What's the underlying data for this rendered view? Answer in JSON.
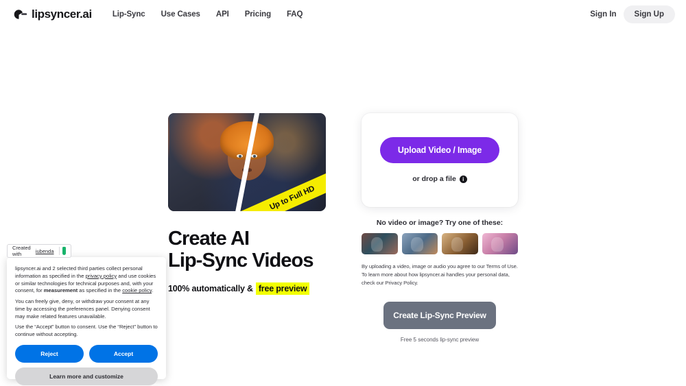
{
  "header": {
    "logo_icon": "lipsyncer-mark-icon",
    "brand": "lipsyncer.ai",
    "nav": [
      {
        "label": "Lip-Sync"
      },
      {
        "label": "Use Cases"
      },
      {
        "label": "API"
      },
      {
        "label": "Pricing"
      },
      {
        "label": "FAQ"
      }
    ],
    "sign_in": "Sign In",
    "sign_up": "Sign Up"
  },
  "hero": {
    "ribbon": "Up to Full HD",
    "title_line1": "Create AI",
    "title_line2": "Lip-Sync Videos",
    "sub_prefix": "100% automatically &",
    "sub_highlight": "free preview"
  },
  "upload": {
    "button": "Upload Video / Image",
    "drop_text": "or drop a file",
    "info_icon": "info-icon",
    "try_label": "No video or image? Try one of these:",
    "samples": [
      {
        "name": "sample-1"
      },
      {
        "name": "sample-2"
      },
      {
        "name": "sample-3"
      },
      {
        "name": "sample-4"
      }
    ],
    "legal": "By uploading a video, image or audio you agree to our Terms of Use. To learn more about how lipsyncer.ai handles your personal data, check our Privacy Policy.",
    "create_button": "Create Lip-Sync Preview",
    "create_note": "Free 5 seconds lip-sync preview"
  },
  "iubenda": {
    "prefix": "Created with",
    "link": "iubenda",
    "shield_icon": "shield-icon"
  },
  "cookie": {
    "p1_a": "lipsyncer.ai and 2 selected third parties collect personal information as specified in the ",
    "p1_link1": "privacy policy",
    "p1_b": " and use cookies or similar technologies for technical purposes and, with your consent, for ",
    "p1_bold": "measurement",
    "p1_c": " as specified in the ",
    "p1_link2": "cookie policy",
    "p1_d": ".",
    "p2": "You can freely give, deny, or withdraw your consent at any time by accessing the preferences panel. Denying consent may make related features unavailable.",
    "p3": "Use the “Accept” button to consent. Use the “Reject” button to continue without accepting.",
    "reject": "Reject",
    "accept": "Accept",
    "learn_more": "Learn more and customize"
  },
  "colors": {
    "purple": "#7c2ae8",
    "yellow": "#f2ff00",
    "ribbon_yellow": "#f5ec00",
    "cta_gray": "#6b7280",
    "consent_blue": "#0073e6"
  }
}
